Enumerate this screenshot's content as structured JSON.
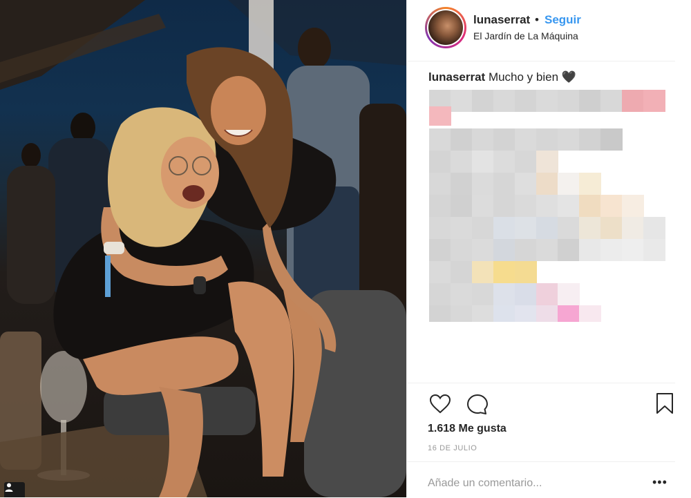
{
  "post": {
    "username": "lunaserrat",
    "separator": "•",
    "follow_label": "Seguir",
    "location": "El Jardín de La Máquina",
    "caption_user": "lunaserrat",
    "caption_text": "Mucho y bien 🖤",
    "likes": "1.618 Me gusta",
    "date": "16 DE JULIO"
  },
  "comment": {
    "placeholder": "Añade un comentario...",
    "more_label": "•••"
  },
  "icons": {
    "like": "heart-icon",
    "comment": "comment-bubble-icon",
    "save": "bookmark-icon",
    "photo_user": "user-icon"
  },
  "colors": {
    "follow": "#3897f0",
    "avatar_ring": "#dd2a7b",
    "muted_text": "#999999"
  }
}
